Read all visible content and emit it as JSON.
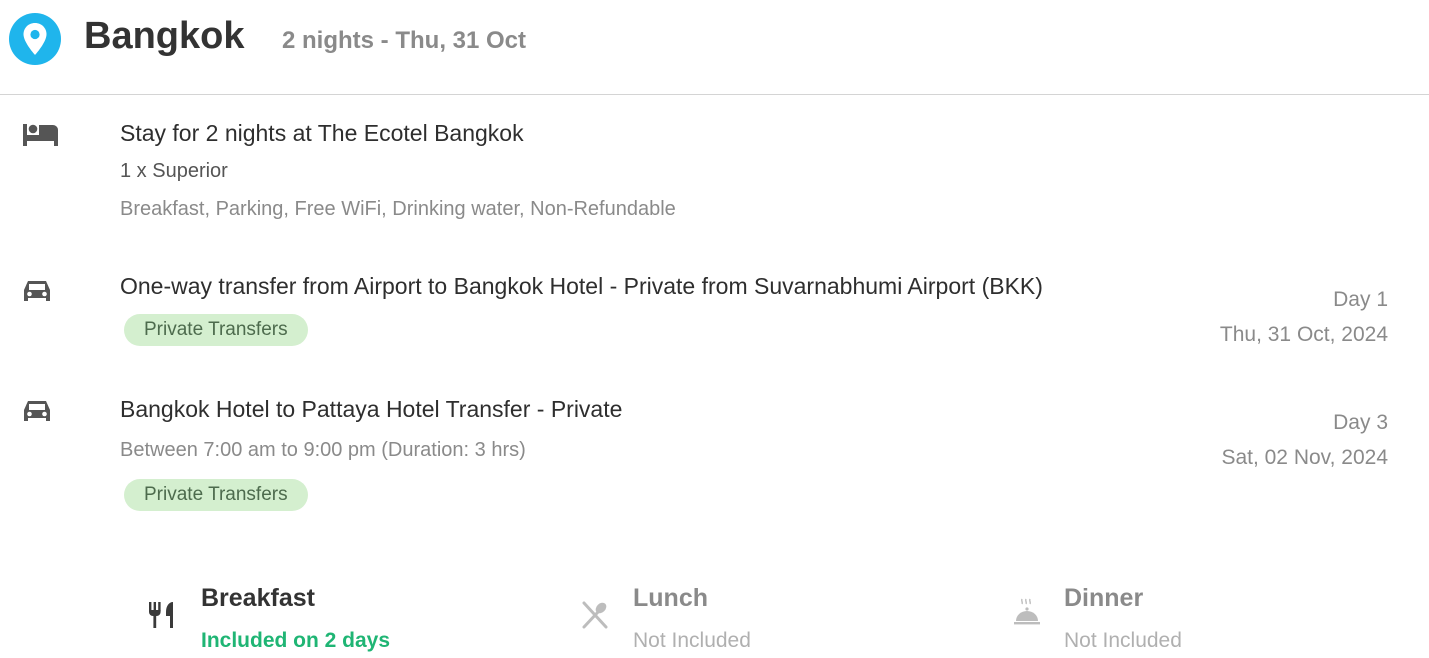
{
  "header": {
    "pin_icon": "location-pin-icon",
    "city": "Bangkok",
    "nights_label": "2 nights - Thu, 31 Oct",
    "accent_color": "#1fb5ec"
  },
  "stay": {
    "icon": "bed-icon",
    "title": "Stay for 2 nights at The Ecotel Bangkok",
    "room": "1 x Superior",
    "amenities": "Breakfast, Parking, Free WiFi, Drinking water, Non-Refundable"
  },
  "transfers": [
    {
      "icon": "car-icon",
      "title": "One-way transfer from Airport to Bangkok Hotel - Private from Suvarnabhumi Airport (BKK)",
      "timing": "",
      "badge": "Private Transfers",
      "day": "Day 1",
      "date": "Thu, 31 Oct, 2024"
    },
    {
      "icon": "car-icon",
      "title": "Bangkok Hotel to Pattaya Hotel Transfer - Private",
      "timing": "Between 7:00 am to 9:00 pm (Duration: 3 hrs)",
      "badge": "Private Transfers",
      "day": "Day 3",
      "date": "Sat, 02 Nov, 2024"
    }
  ],
  "meals": [
    {
      "icon": "fork-knife-icon",
      "name": "Breakfast",
      "status": "Included on 2 days",
      "included": true
    },
    {
      "icon": "crossed-cutlery-icon",
      "name": "Lunch",
      "status": "Not Included",
      "included": false
    },
    {
      "icon": "cloche-icon",
      "name": "Dinner",
      "status": "Not Included",
      "included": false
    }
  ],
  "colors": {
    "included_green": "#1fb574",
    "badge_bg": "#d4efcf",
    "muted": "#8a8a8a"
  }
}
